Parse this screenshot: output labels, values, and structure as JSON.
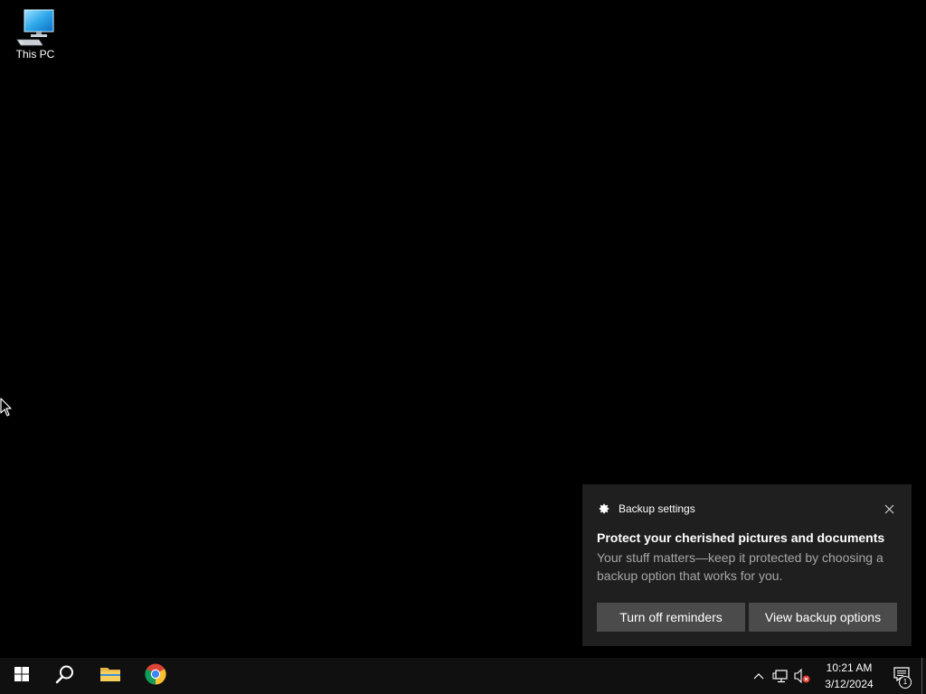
{
  "desktop": {
    "icons": [
      {
        "label": "This PC",
        "icon": "this-pc-icon"
      }
    ]
  },
  "toast": {
    "app_name": "Backup settings",
    "app_icon": "gear-icon",
    "title": "Protect your cherished pictures and documents",
    "body": "Your stuff matters—keep it protected by choosing a backup option that works for you.",
    "actions": [
      {
        "label": "Turn off reminders"
      },
      {
        "label": "View backup options"
      }
    ],
    "close_icon": "close-icon"
  },
  "taskbar": {
    "start_icon": "windows-start-icon",
    "search_icon": "search-icon",
    "pinned": [
      {
        "name": "file-explorer-icon"
      },
      {
        "name": "chrome-icon"
      }
    ],
    "tray": {
      "overflow_icon": "chevron-up-icon",
      "network_icon": "network-icon",
      "volume_icon": "volume-muted-icon",
      "time": "10:21 AM",
      "date": "3/12/2024",
      "notification_count": "1"
    }
  },
  "colors": {
    "desktop_bg": "#000000",
    "taskbar_bg": "#101010",
    "toast_bg": "#1f1f1f",
    "toast_button_bg": "#4b4b4b",
    "toast_body_text": "#a6a6a6",
    "windows_blue": "#0078d7"
  }
}
